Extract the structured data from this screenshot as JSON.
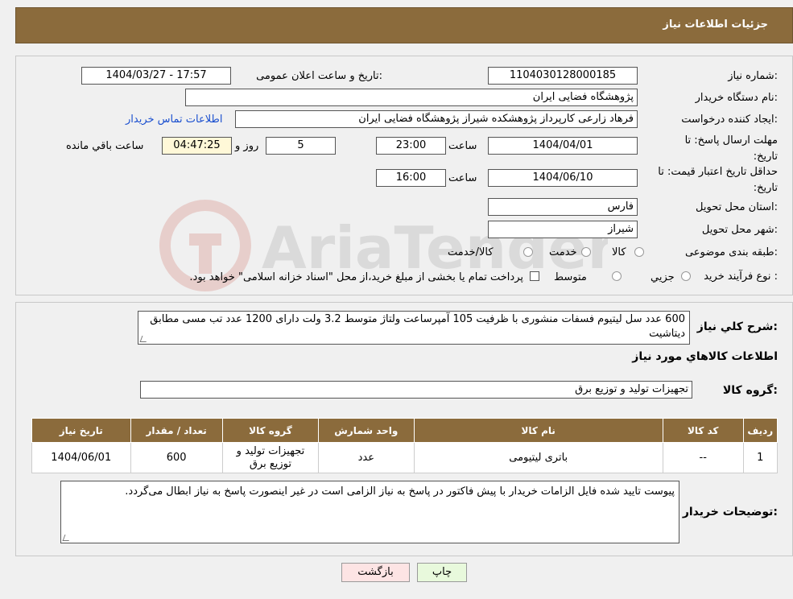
{
  "header": {
    "title": "جزئیات اطلاعات نیاز"
  },
  "form": {
    "need_number": {
      "label": "شماره نیاز:",
      "value": "1104030128000185"
    },
    "announce": {
      "label": "تاریخ و ساعت اعلان عمومی:",
      "value": "1404/03/27 - 17:57"
    },
    "buyer_org": {
      "label": "نام دستگاه خریدار:",
      "value": "پژوهشگاه فضایی ایران"
    },
    "requester": {
      "label": "ایجاد کننده درخواست:",
      "value": "فرهاد زارعی کارپرداز پژوهشکده شیراز پژوهشگاه فضایی ایران",
      "contact_link": "اطلاعات تماس خریدار"
    },
    "deadline": {
      "label": "مهلت ارسال پاسخ: تا تاریخ:",
      "date": "1404/04/01",
      "time_label": "ساعت",
      "time": "23:00",
      "days": "5",
      "days_label": "روز و",
      "remaining": "04:47:25",
      "remaining_label": "ساعت باقي مانده"
    },
    "validity": {
      "label": "حداقل تاریخ اعتبار قیمت: تا تاریخ:",
      "date": "1404/06/10",
      "time_label": "ساعت",
      "time": "16:00"
    },
    "province": {
      "label": "استان محل تحویل:",
      "value": "فارس"
    },
    "city": {
      "label": "شهر محل تحویل:",
      "value": "شیراز"
    },
    "category": {
      "label": "طبقه بندی موضوعی:",
      "options": [
        "کالا",
        "خدمت",
        "کالا/خدمت"
      ]
    },
    "process": {
      "label": "نوع فرآیند خرید :",
      "options": [
        "جزیي",
        "متوسط"
      ],
      "note": "پرداخت تمام یا بخشی از مبلغ خرید،از محل \"اسناد خزانه اسلامی\" خواهد بود."
    }
  },
  "description": {
    "label": "شرح کلي نیاز:",
    "value": "600 عدد سل لیتیوم فسفات منشوری با ظرفیت 105 آمپرساعت ولتاژ متوسط 3.2 ولت دارای 1200 عدد تب مسی مطابق دیتاشیت"
  },
  "goods_info": {
    "title": "اطلاعات کالاهاي مورد نیاز"
  },
  "goods_group": {
    "label": "گروه کالا:",
    "value": "تجهیزات تولید و توزیع برق"
  },
  "table": {
    "headers": [
      "ردیف",
      "کد کالا",
      "نام کالا",
      "واحد شمارش",
      "گروه کالا",
      "تعداد / مقدار",
      "تاریخ نیاز"
    ],
    "rows": [
      [
        "1",
        "--",
        "باتری لیتیومی",
        "عدد",
        "تجهیزات تولید و توزیع برق",
        "600",
        "1404/06/01"
      ]
    ]
  },
  "buyer_notes": {
    "label": "توضیحات خریدار:",
    "value": "پیوست تایید شده فایل الزامات خریدار با پیش فاکتور در پاسخ به نیاز الزامی است در غیر اینصورت پاسخ به نیاز ابطال می‌گردد."
  },
  "buttons": {
    "print": "چاپ",
    "back": "بازگشت"
  },
  "watermark": {
    "text": "AriaTender.neT"
  },
  "colors": {
    "header": "#8b6b3c",
    "link": "#1a4fcf",
    "print_btn": "#e8f9dc",
    "back_btn": "#fde4e4"
  }
}
